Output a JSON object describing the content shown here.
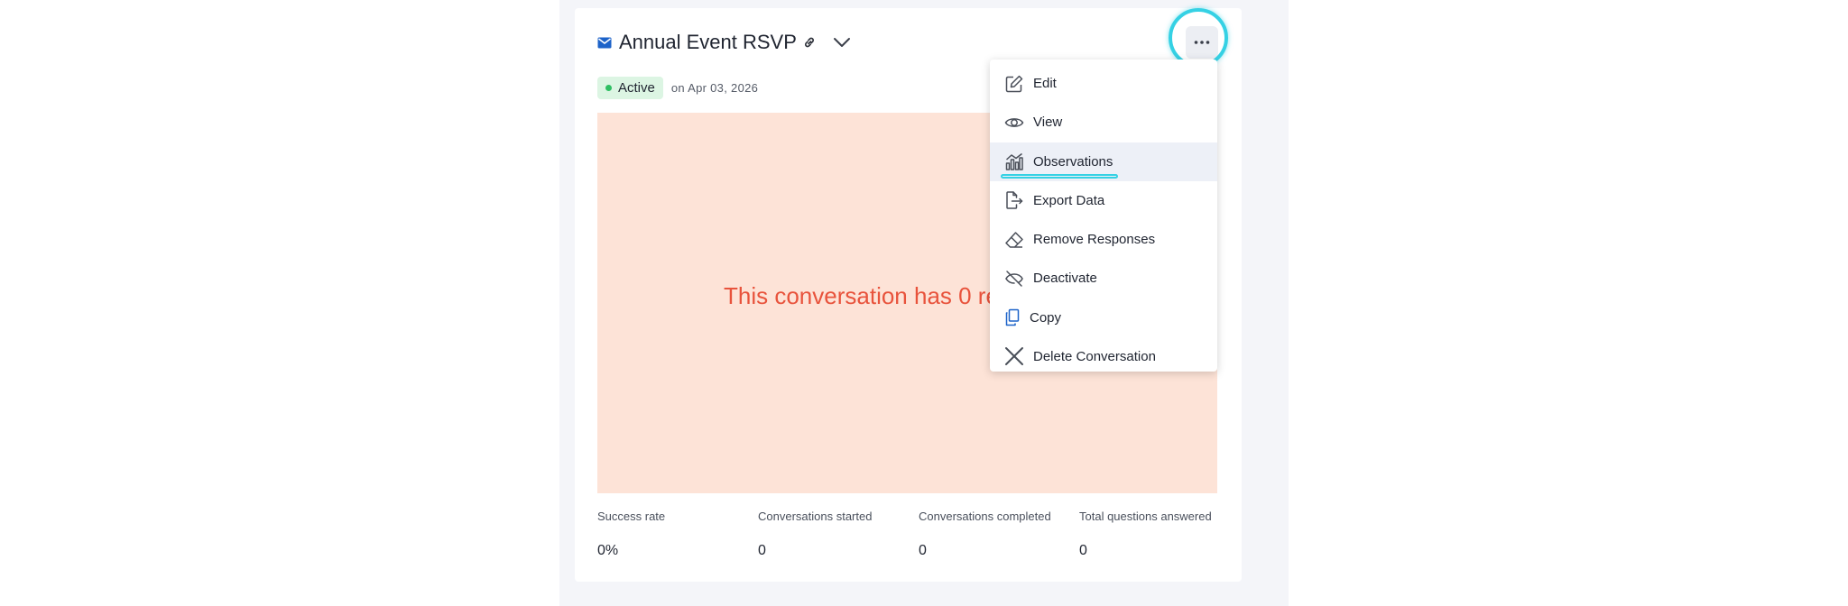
{
  "header": {
    "title": "Annual Event RSVP",
    "title_icon": "mail-icon",
    "link_icon": "link-icon",
    "expand_icon": "chevron-down-icon",
    "more_icon": "more-horizontal-icon"
  },
  "status": {
    "label": "Active",
    "date_text": "on Apr 03, 2026",
    "color": "#2fbf63"
  },
  "panel": {
    "message": "This conversation has 0 responses"
  },
  "stats": [
    {
      "label": "Success rate",
      "value": "0%"
    },
    {
      "label": "Conversations started",
      "value": "0"
    },
    {
      "label": "Conversations completed",
      "value": "0"
    },
    {
      "label": "Total questions answered",
      "value": "0"
    }
  ],
  "menu": {
    "items": [
      {
        "label": "Edit",
        "icon": "edit-icon"
      },
      {
        "label": "View",
        "icon": "eye-icon"
      },
      {
        "label": "Observations",
        "icon": "chart-icon",
        "highlighted": true
      },
      {
        "label": "Export Data",
        "icon": "export-icon"
      },
      {
        "label": "Remove Responses",
        "icon": "eraser-icon"
      },
      {
        "label": "Deactivate",
        "icon": "deactivate-icon"
      },
      {
        "label": "Copy",
        "icon": "copy-icon"
      },
      {
        "label": "Delete Conversation",
        "icon": "close-icon"
      }
    ]
  },
  "colors": {
    "accent_ring": "#35d1e4",
    "panel_bg": "#fde3d7",
    "message": "#e8533c",
    "brand_blue": "#1d63c9"
  }
}
